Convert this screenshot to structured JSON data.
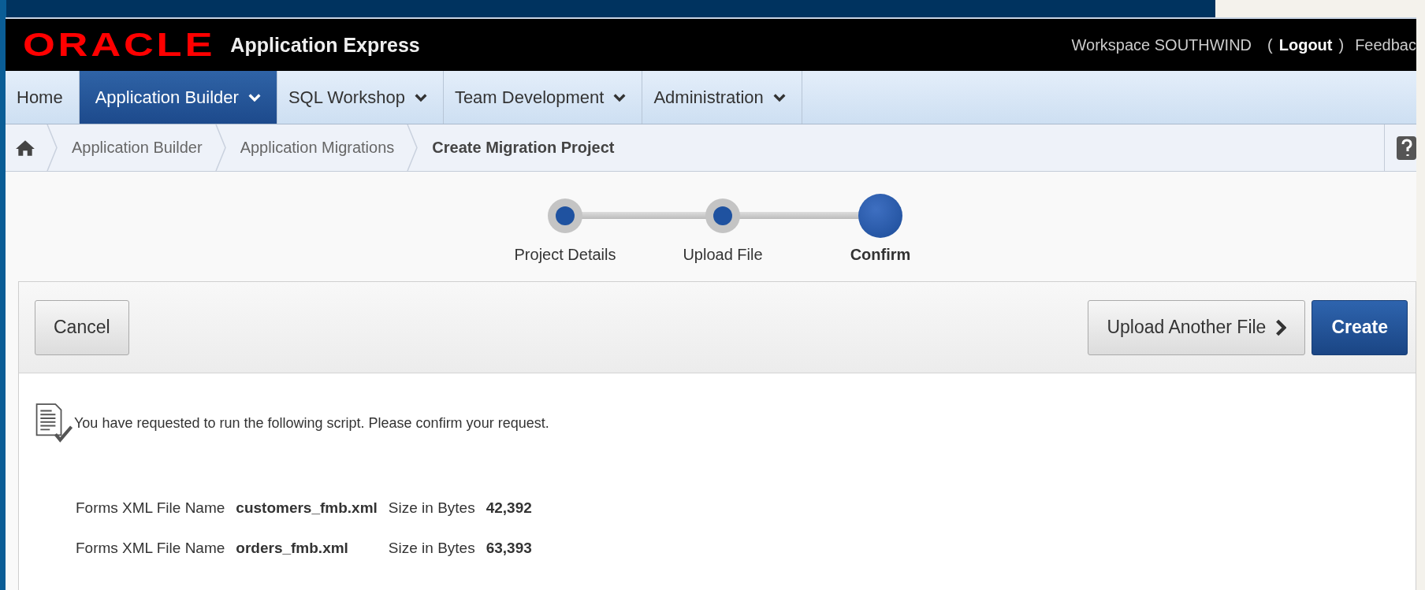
{
  "header": {
    "logo": "ORACLE",
    "product": "Application Express",
    "workspace": "Workspace SOUTHWIND",
    "open_paren": "(",
    "logout": "Logout",
    "close_paren": ")",
    "feedback": "Feedbac"
  },
  "tabs": [
    {
      "label": "Home",
      "selected": false,
      "has_menu": false
    },
    {
      "label": "Application Builder",
      "selected": true,
      "has_menu": true
    },
    {
      "label": "SQL Workshop",
      "selected": false,
      "has_menu": true
    },
    {
      "label": "Team Development",
      "selected": false,
      "has_menu": true
    },
    {
      "label": "Administration",
      "selected": false,
      "has_menu": true
    }
  ],
  "breadcrumb": [
    {
      "label": "Application Builder",
      "current": false
    },
    {
      "label": "Application Migrations",
      "current": false
    },
    {
      "label": "Create Migration Project",
      "current": true
    }
  ],
  "wizard_steps": [
    {
      "label": "Project Details",
      "selected": false
    },
    {
      "label": "Upload File",
      "selected": false
    },
    {
      "label": "Confirm",
      "selected": true
    }
  ],
  "buttons": [
    {
      "label": "Cancel",
      "kind": "plain"
    },
    {
      "label": "Upload Another File",
      "kind": "next"
    },
    {
      "label": "Create",
      "kind": "primary"
    }
  ],
  "message": "You have requested to run the following script. Please confirm your request.",
  "files": [
    {
      "name_label": "Forms XML File Name",
      "name": "customers_fmb.xml",
      "size_label": "Size in Bytes",
      "size": "42,392"
    },
    {
      "name_label": "Forms XML File Name",
      "name": "orders_fmb.xml",
      "size_label": "Size in Bytes",
      "size": "63,393"
    }
  ]
}
